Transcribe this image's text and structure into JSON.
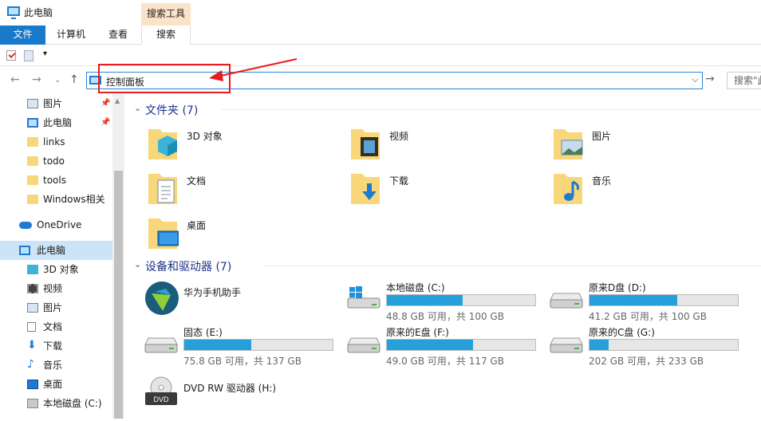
{
  "window": {
    "title": "此电脑",
    "context_tab": "搜索工具"
  },
  "ribbon": {
    "tabs": [
      "文件",
      "计算机",
      "查看",
      "搜索"
    ]
  },
  "address": {
    "path": "控制面板",
    "search_placeholder": "搜索\"此"
  },
  "sidebar": {
    "items": [
      {
        "label": "图片",
        "icon": "pictures-icon",
        "pinned": true
      },
      {
        "label": "此电脑",
        "icon": "pc-icon",
        "pinned": true
      },
      {
        "label": "links",
        "icon": "folder-icon"
      },
      {
        "label": "todo",
        "icon": "folder-icon"
      },
      {
        "label": "tools",
        "icon": "folder-icon"
      },
      {
        "label": "Windows相关",
        "icon": "folder-icon"
      },
      {
        "label": "OneDrive",
        "icon": "cloud-icon"
      },
      {
        "label": "此电脑",
        "icon": "pc-icon",
        "selected": true
      },
      {
        "label": "3D 对象",
        "icon": "3d-objects-icon"
      },
      {
        "label": "视频",
        "icon": "video-icon"
      },
      {
        "label": "图片",
        "icon": "pictures-icon"
      },
      {
        "label": "文档",
        "icon": "documents-icon"
      },
      {
        "label": "下载",
        "icon": "download-icon"
      },
      {
        "label": "音乐",
        "icon": "music-icon"
      },
      {
        "label": "桌面",
        "icon": "desktop-icon"
      },
      {
        "label": "本地磁盘 (C:)",
        "icon": "drive-icon"
      }
    ]
  },
  "folders": {
    "header": "文件夹 (7)",
    "items": [
      "3D 对象",
      "视频",
      "图片",
      "文档",
      "下载",
      "音乐",
      "桌面"
    ]
  },
  "devices": {
    "header": "设备和驱动器 (7)",
    "app": "华为手机助手",
    "drives": [
      {
        "name": "本地磁盘 (C:)",
        "info": "48.8 GB 可用，共 100 GB",
        "used": 0.51
      },
      {
        "name": "原来D盘 (D:)",
        "info": "41.2 GB 可用，共 100 GB",
        "used": 0.59
      },
      {
        "name": "固态 (E:)",
        "info": "75.8 GB 可用，共 137 GB",
        "used": 0.45
      },
      {
        "name": "原来的E盘 (F:)",
        "info": "49.0 GB 可用，共 117 GB",
        "used": 0.58
      },
      {
        "name": "原来的C盘 (G:)",
        "info": "202 GB 可用，共 233 GB",
        "used": 0.13
      }
    ],
    "dvd": "DVD RW 驱动器 (H:)"
  },
  "colors": {
    "accent": "#1979ca",
    "drive_fill": "#26a0da",
    "annotation": "#e81c1c"
  }
}
